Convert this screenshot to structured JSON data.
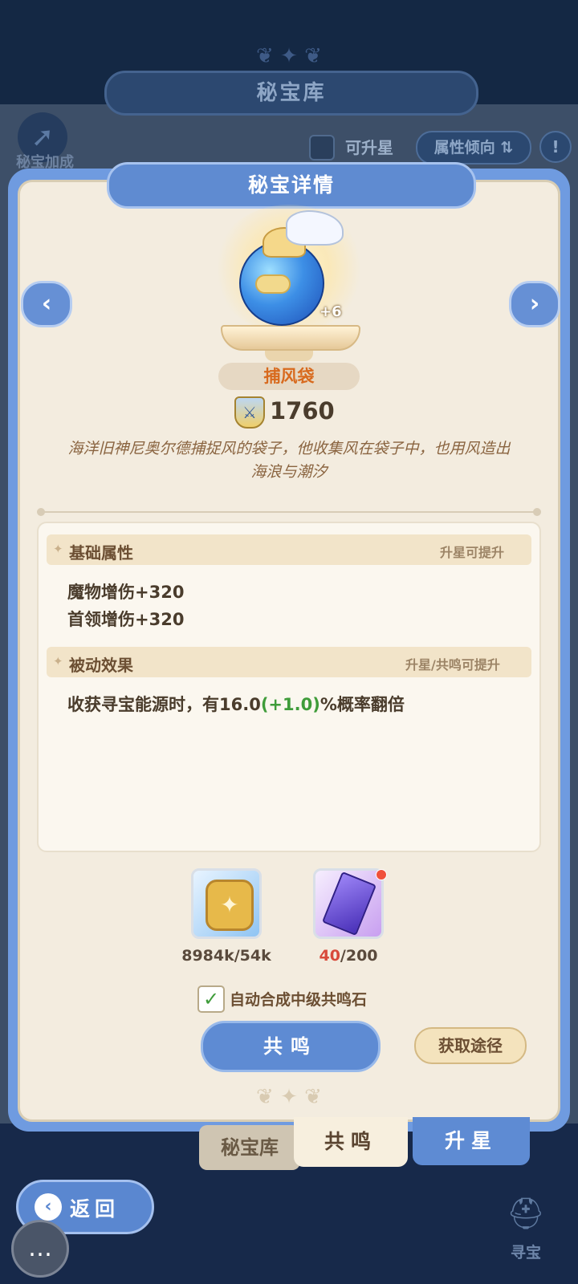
{
  "background": {
    "vault_title": "秘宝库",
    "bonus_label": "秘宝加成",
    "upstar_filter_label": "可升星",
    "attribute_sort_label": "属性倾向",
    "info_icon": "!"
  },
  "panel": {
    "title": "秘宝详情",
    "prev_icon": "chevron-left-icon",
    "next_icon": "chevron-right-icon"
  },
  "item": {
    "name": "捕风袋",
    "level": "+6",
    "power": "1760",
    "description": "海洋旧神尼奥尔德捕捉风的袋子，他收集风在袋子中，也用风造出海浪与潮汐"
  },
  "base_attributes": {
    "title": "基础属性",
    "hint": "升星可提升",
    "stats": [
      "魔物增伤+320",
      "首领增伤+320"
    ]
  },
  "passive": {
    "title": "被动效果",
    "hint": "升星/共鸣可提升",
    "text_before": "收获寻宝能源时，有16.0",
    "bonus": "(+1.0)",
    "text_after": "%概率翻倍"
  },
  "materials": [
    {
      "icon": "gold-coin-icon",
      "count": "8984k/54k"
    },
    {
      "icon": "purple-crystal-icon",
      "have": "40",
      "need": "/200",
      "has_alert": true
    }
  ],
  "auto_synthesize": {
    "checked": true,
    "label": "自动合成中级共鸣石"
  },
  "buttons": {
    "resonate": "共鸣",
    "acquire": "获取途径"
  },
  "tabs": {
    "vault": "秘宝库",
    "resonate": "共鸣",
    "upstar": "升星"
  },
  "nav": {
    "back": "返回",
    "treasure": "寻宝"
  },
  "colors": {
    "accent_blue": "#5e8bd3",
    "name_orange": "#d86a1e",
    "bonus_green": "#3f9c3a",
    "material_shortfall_red": "#d84a3a"
  }
}
